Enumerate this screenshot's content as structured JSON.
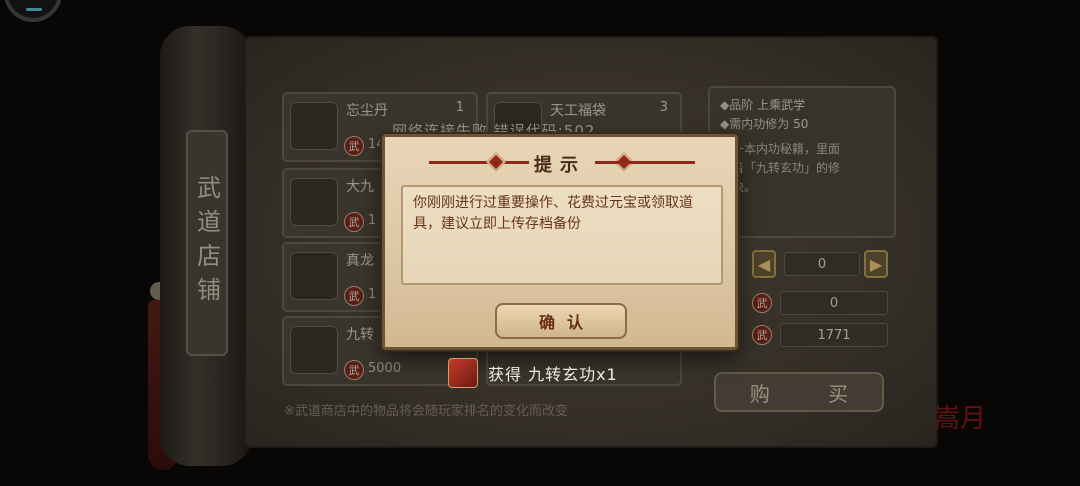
{
  "background": {
    "left_column_lines": [
      "",
      "",
      "",
      ""
    ],
    "right_column_lines": [
      "",
      "",
      "",
      ""
    ]
  },
  "shop": {
    "tab_label": "武道店铺",
    "items": [
      {
        "name": "忘尘丹",
        "count": "1",
        "price": "14",
        "currency": "武"
      },
      {
        "name": "天工福袋",
        "count": "3",
        "price": "",
        "currency": ""
      },
      {
        "name": "大九",
        "count": "",
        "price": "1",
        "currency": "武"
      },
      {
        "name": "",
        "count": "",
        "price": "",
        "currency": ""
      },
      {
        "name": "真龙",
        "count": "",
        "price": "1",
        "currency": "武"
      },
      {
        "name": "",
        "count": "",
        "price": "",
        "currency": ""
      },
      {
        "name": "九转",
        "count": "",
        "price": "5000",
        "currency": "武"
      },
      {
        "name": "",
        "count": "",
        "price": "",
        "currency": ""
      }
    ],
    "detail": {
      "rank_label": "◆品阶",
      "rank_value": "上乘武学",
      "req_label": "◆需内功修为",
      "req_value": "50",
      "desc": "是一本内功秘籍，里面\n载着「九转玄功」的修\n口诀。"
    },
    "quantity": "0",
    "cost": "0",
    "owned": "1771",
    "buy_label": "购 买",
    "footer_note": "※武道商店中的物品将会随玩家排名的变化而改变",
    "watermark": "嵩月"
  },
  "network_message": "网络连接失败 错误代码:502",
  "dialog": {
    "title": "提示",
    "message": "你刚刚进行过重要操作、花费过元宝或领取道具，建议立即上传存档备份",
    "confirm_label": "确认"
  },
  "toast": {
    "text": "获得 九转玄功x1"
  },
  "colors": {
    "dialog_bg": "#dcc6a2",
    "dialog_text": "#6a3418",
    "accent_red": "#8e2a1c",
    "panel_bg": "#4a4238"
  }
}
